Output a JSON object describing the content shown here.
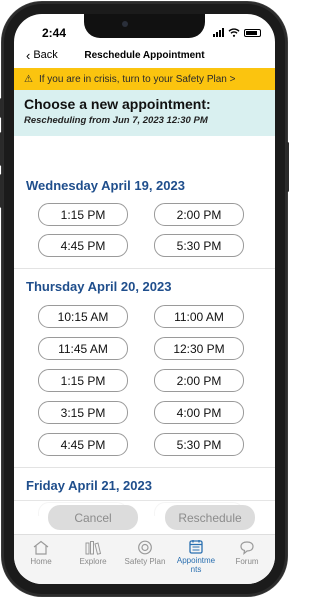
{
  "status": {
    "time": "2:44"
  },
  "nav": {
    "back_label": "Back",
    "title": "Reschedule Appointment"
  },
  "crisis_banner": {
    "text": "If you are in crisis, turn to your Safety Plan >"
  },
  "header": {
    "title": "Choose a new appointment:",
    "subtitle": "Rescheduling from Jun 7, 2023 12:30 PM"
  },
  "days": [
    {
      "label": "Wednesday April 19, 2023",
      "slots": [
        "1:15 PM",
        "2:00 PM",
        "4:45 PM",
        "5:30 PM"
      ]
    },
    {
      "label": "Thursday April 20, 2023",
      "slots": [
        "10:15 AM",
        "11:00 AM",
        "11:45 AM",
        "12:30 PM",
        "1:15 PM",
        "2:00 PM",
        "3:15 PM",
        "4:00 PM",
        "4:45 PM",
        "5:30 PM"
      ]
    },
    {
      "label": "Friday April 21, 2023",
      "slots": []
    }
  ],
  "actions": {
    "cancel_label": "Cancel",
    "reschedule_label": "Reschedule"
  },
  "tabs": [
    {
      "label": "Home",
      "icon": "home-icon"
    },
    {
      "label": "Explore",
      "icon": "explore-icon"
    },
    {
      "label": "Safety Plan",
      "icon": "lifebuoy-icon"
    },
    {
      "label": "Appointme\nnts",
      "icon": "calendar-icon",
      "active": true
    },
    {
      "label": "Forum",
      "icon": "chat-icon"
    }
  ],
  "colors": {
    "banner": "#fbc40f",
    "header_bg": "#d9f0f0",
    "day_label": "#1f4e8c",
    "active_tab": "#2a6fb0"
  }
}
